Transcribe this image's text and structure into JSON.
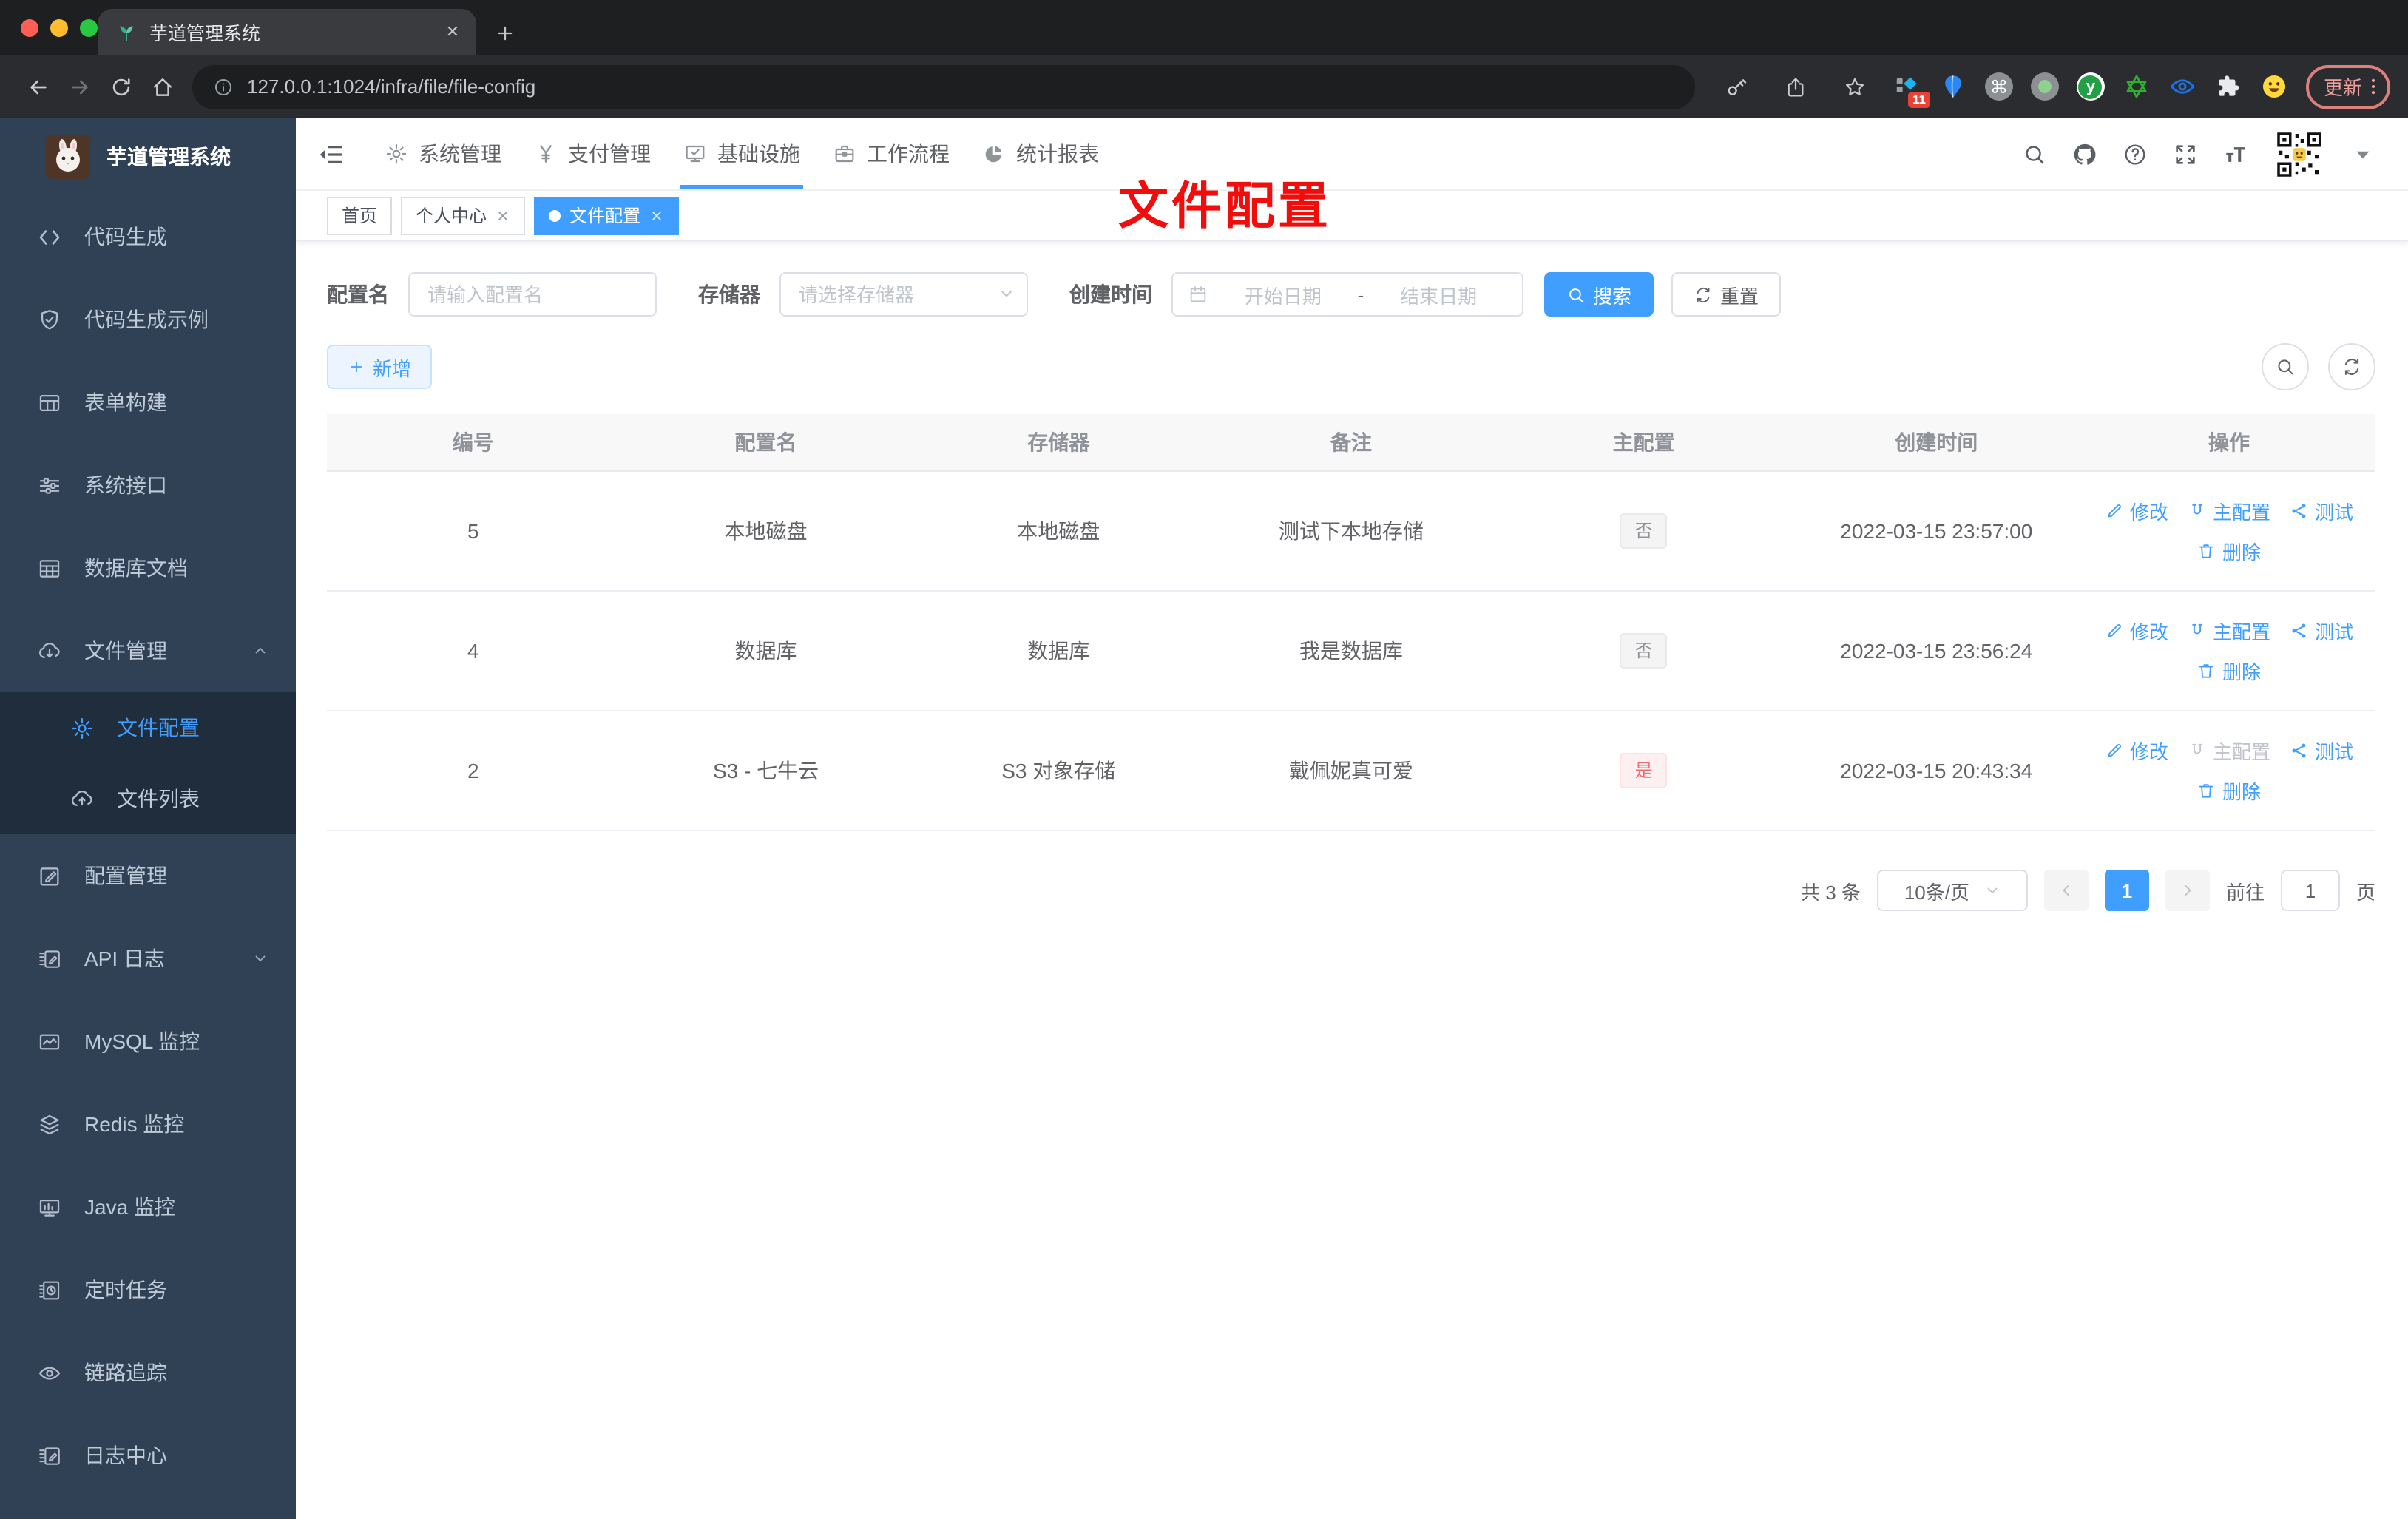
{
  "browser": {
    "tab_title": "芋道管理系统",
    "url": "127.0.0.1:1024/infra/file/file-config",
    "extension_badge": "11",
    "update_label": "更新"
  },
  "sidebar": {
    "title": "芋道管理系统",
    "items": [
      {
        "label": "代码生成",
        "icon": "code"
      },
      {
        "label": "代码生成示例",
        "icon": "shield-check"
      },
      {
        "label": "表单构建",
        "icon": "form"
      },
      {
        "label": "系统接口",
        "icon": "sliders"
      },
      {
        "label": "数据库文档",
        "icon": "grid"
      },
      {
        "label": "文件管理",
        "icon": "cloud-down"
      },
      {
        "label": "文件配置",
        "icon": "gear"
      },
      {
        "label": "文件列表",
        "icon": "cloud-up"
      },
      {
        "label": "配置管理",
        "icon": "pen-square"
      },
      {
        "label": "API 日志",
        "icon": "doc-pen"
      },
      {
        "label": "MySQL 监控",
        "icon": "chart-monitor"
      },
      {
        "label": "Redis 监控",
        "icon": "layers"
      },
      {
        "label": "Java 监控",
        "icon": "monitor"
      },
      {
        "label": "定时任务",
        "icon": "schedule"
      },
      {
        "label": "链路追踪",
        "icon": "eye"
      },
      {
        "label": "日志中心",
        "icon": "doc-pen"
      }
    ]
  },
  "topnav": {
    "items": [
      {
        "label": "系统管理",
        "icon": "gear"
      },
      {
        "label": "支付管理",
        "icon": "yen"
      },
      {
        "label": "基础设施",
        "icon": "infra"
      },
      {
        "label": "工作流程",
        "icon": "briefcase"
      },
      {
        "label": "统计报表",
        "icon": "pie"
      }
    ]
  },
  "tags": {
    "items": [
      {
        "label": "首页"
      },
      {
        "label": "个人中心"
      },
      {
        "label": "文件配置"
      }
    ]
  },
  "annotation": "文件配置",
  "filters": {
    "name_label": "配置名",
    "name_placeholder": "请输入配置名",
    "storage_label": "存储器",
    "storage_placeholder": "请选择存储器",
    "date_label": "创建时间",
    "date_start": "开始日期",
    "date_separator": "-",
    "date_end": "结束日期",
    "search_label": "搜索",
    "reset_label": "重置"
  },
  "toolbar": {
    "add_label": "新增"
  },
  "table": {
    "columns": [
      "编号",
      "配置名",
      "存储器",
      "备注",
      "主配置",
      "创建时间",
      "操作"
    ],
    "actions": {
      "edit": "修改",
      "master": "主配置",
      "test": "测试",
      "remove": "删除"
    },
    "rows": [
      {
        "id": "5",
        "name": "本地磁盘",
        "storage": "本地磁盘",
        "remark": "测试下本地存储",
        "master": "否",
        "created": "2022-03-15 23:57:00"
      },
      {
        "id": "4",
        "name": "数据库",
        "storage": "数据库",
        "remark": "我是数据库",
        "master": "否",
        "created": "2022-03-15 23:56:24"
      },
      {
        "id": "2",
        "name": "S3 - 七牛云",
        "storage": "S3 对象存储",
        "remark": "戴佩妮真可爱",
        "master": "是",
        "created": "2022-03-15 20:43:34"
      }
    ]
  },
  "pagination": {
    "total": "共 3 条",
    "page_size": "10条/页",
    "page": "1",
    "goto": "前往",
    "goto_value": "1",
    "unit": "页"
  },
  "colors": {
    "accent": "#409eff",
    "danger": "#f56c6c",
    "sidebar_bg": "#304156",
    "submenu_bg": "#1f2d3d",
    "annotation_red": "#f20d0d"
  }
}
